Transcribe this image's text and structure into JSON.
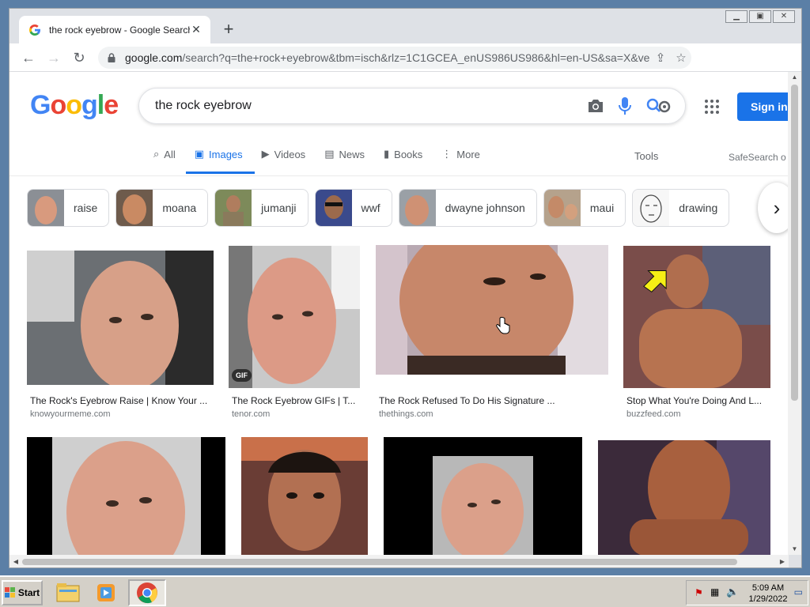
{
  "browser": {
    "tab_title": "the rock eyebrow - Google Search",
    "url_host": "google.com",
    "url_path": "/search?q=the+rock+eyebrow&tbm=isch&rlz=1C1GCEA_enUS986US986&hl=en-US&sa=X&ved..."
  },
  "google": {
    "logo": [
      "G",
      "o",
      "o",
      "g",
      "l",
      "e"
    ],
    "query": "the rock eyebrow",
    "sign_in": "Sign in",
    "tabs": [
      "All",
      "Images",
      "Videos",
      "News",
      "Books",
      "More"
    ],
    "tools": "Tools",
    "safesearch": "SafeSearch o"
  },
  "chips": [
    "raise",
    "moana",
    "jumanji",
    "wwf",
    "dwayne johnson",
    "maui",
    "drawing"
  ],
  "results": [
    {
      "caption": "The Rock's Eyebrow Raise | Know Your ...",
      "source": "knowyourmeme.com"
    },
    {
      "caption": "The Rock Eyebrow GIFs | T...",
      "source": "tenor.com",
      "badge": "GIF"
    },
    {
      "caption": "The Rock Refused To Do His Signature ...",
      "source": "thethings.com"
    },
    {
      "caption": "Stop What You're Doing And L...",
      "source": "buzzfeed.com"
    }
  ],
  "taskbar": {
    "start": "Start",
    "time": "5:09 AM",
    "date": "1/29/2022"
  }
}
